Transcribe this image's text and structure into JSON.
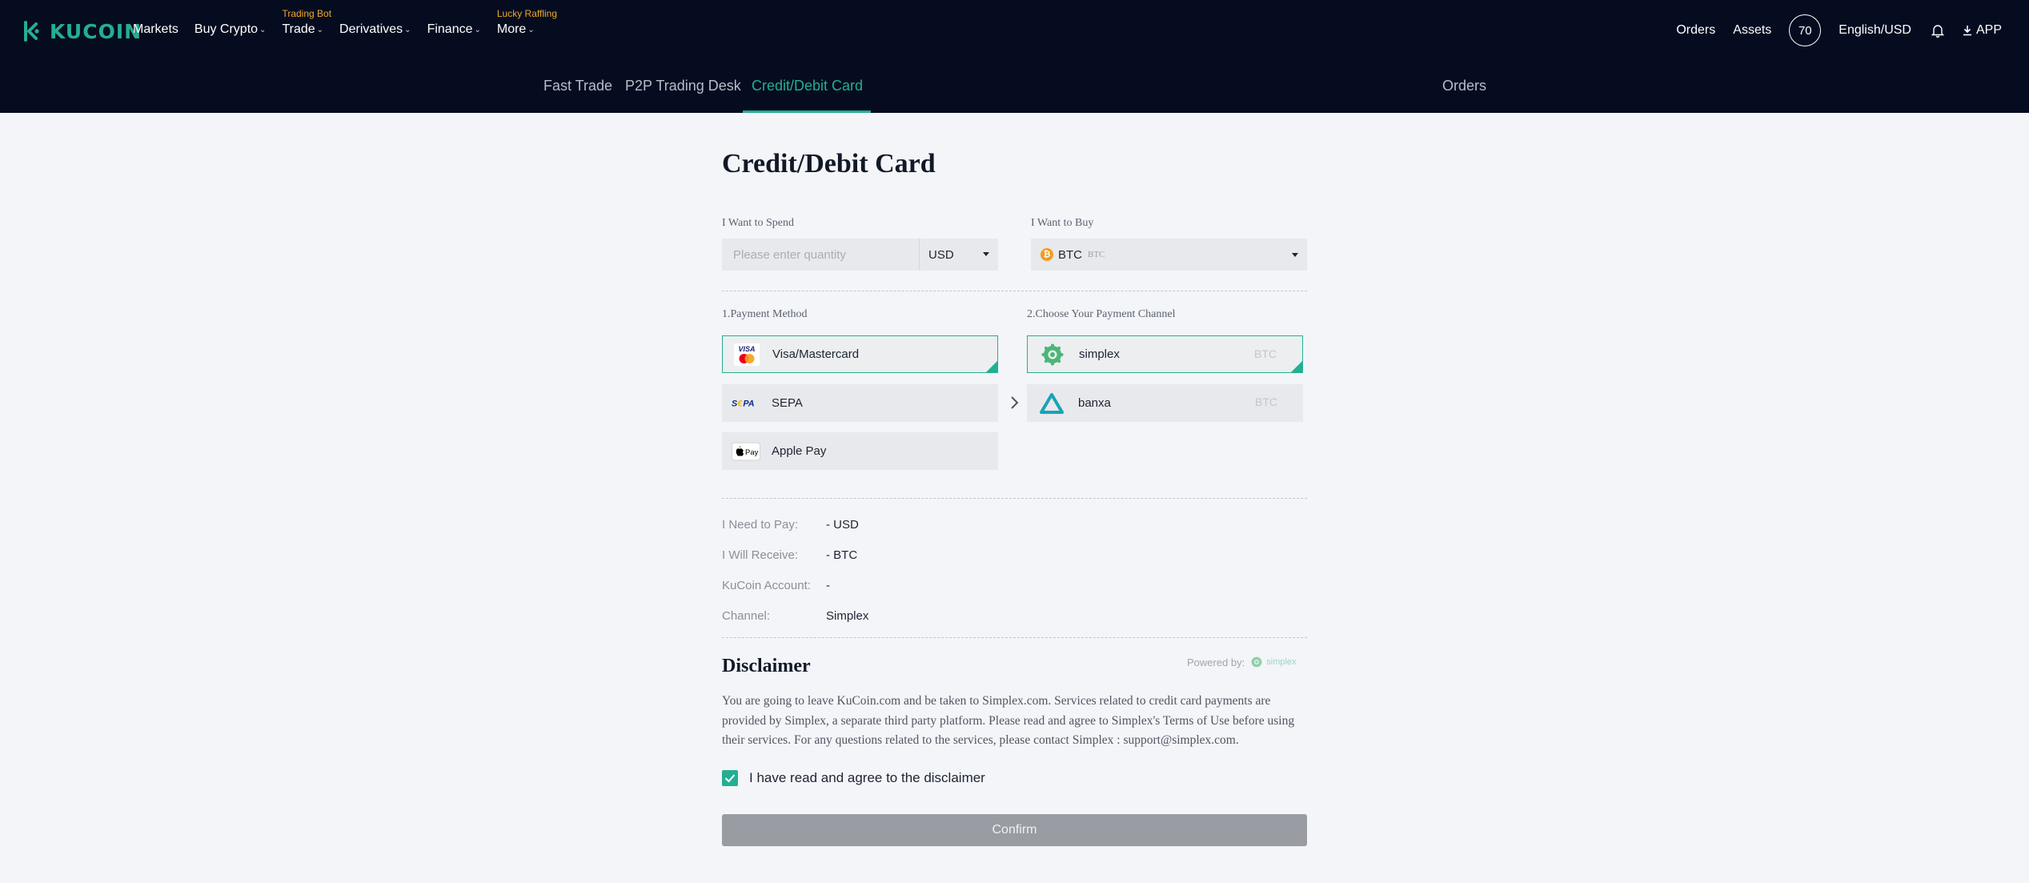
{
  "brand": {
    "name": "KUCOIN",
    "accent": "#23af91",
    "badge_color": "#f0a826"
  },
  "nav": {
    "items": [
      {
        "label": "Markets",
        "badge": "",
        "has_chevron": false
      },
      {
        "label": "Buy Crypto",
        "badge": "",
        "has_chevron": true
      },
      {
        "label": "Trade",
        "badge": "Trading Bot",
        "has_chevron": true
      },
      {
        "label": "Derivatives",
        "badge": "",
        "has_chevron": true
      },
      {
        "label": "Finance",
        "badge": "",
        "has_chevron": true
      },
      {
        "label": "More",
        "badge": "Lucky Raffling",
        "has_chevron": true
      }
    ],
    "right": {
      "orders": "Orders",
      "assets": "Assets",
      "avatar": "70",
      "language": "English/USD",
      "app": "APP"
    }
  },
  "subnav": {
    "tabs": [
      "Fast Trade",
      "P2P Trading Desk",
      "Credit/Debit Card"
    ],
    "active_tab": "Credit/Debit Card",
    "orders": "Orders"
  },
  "page": {
    "title": "Credit/Debit Card"
  },
  "spend": {
    "label": "I Want to Spend",
    "placeholder": "Please enter quantity",
    "value": "",
    "currency": "USD"
  },
  "buy": {
    "label": "I Want to Buy",
    "symbol": "BTC",
    "name": "BTC"
  },
  "payment_method": {
    "label": "1.Payment Method",
    "options": [
      {
        "label": "Visa/Mastercard",
        "icon": "visa-mastercard-icon",
        "selected": true
      },
      {
        "label": "SEPA",
        "icon": "sepa-icon",
        "selected": false
      },
      {
        "label": "Apple Pay",
        "icon": "apple-pay-icon",
        "selected": false
      }
    ]
  },
  "payment_channel": {
    "label": "2.Choose Your Payment Channel",
    "options": [
      {
        "label": "simplex",
        "tag": "BTC",
        "icon": "simplex-icon",
        "selected": true
      },
      {
        "label": "banxa",
        "tag": "BTC",
        "icon": "banxa-icon",
        "selected": false
      }
    ]
  },
  "summary": {
    "need_to_pay": {
      "label": "I Need to Pay:",
      "value": "-  USD"
    },
    "will_receive": {
      "label": "I Will Receive:",
      "value": "-  BTC"
    },
    "account": {
      "label": "KuCoin Account:",
      "value": "-"
    },
    "channel": {
      "label": "Channel:",
      "value": "Simplex"
    }
  },
  "disclaimer": {
    "title": "Disclaimer",
    "powered_by": "Powered by:",
    "powered_brand": "simplex",
    "text": "You are going to leave KuCoin.com and be taken to Simplex.com. Services related to credit card payments are provided by Simplex, a separate third party platform. Please read and agree to Simplex's Terms of Use before using their services. For any questions related to the services, please contact Simplex : support@simplex.com.",
    "agree_label": "I have read and agree to the disclaimer",
    "agreed": true
  },
  "confirm_label": "Confirm"
}
